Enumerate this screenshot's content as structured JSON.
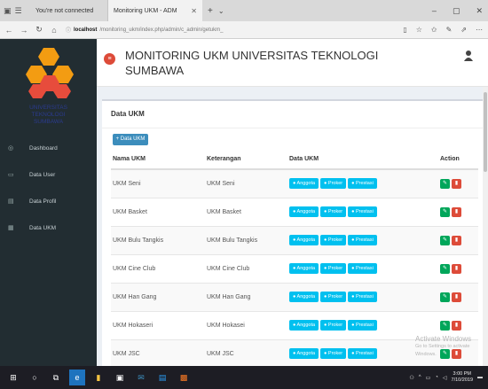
{
  "browser": {
    "tab_inactive": "You're not connected",
    "tab_active": "Monitoring UKM - ADM",
    "new_tab": "+",
    "url_host": "localhost",
    "url_path": "/monitoring_ukm/index.php/admin/c_admin/getukm_"
  },
  "sidebar": {
    "brand_lines": [
      "UNIVERSITAS",
      "TEKNOLOGI",
      "SUMBAWA"
    ],
    "items": [
      {
        "label": "Dashboard",
        "icon": "dashboard-icon"
      },
      {
        "label": "Data User",
        "icon": "monitor-icon"
      },
      {
        "label": "Data Profil",
        "icon": "file-icon"
      },
      {
        "label": "Data UKM",
        "icon": "grid-icon"
      }
    ]
  },
  "header": {
    "title": "MONITORING UKM UNIVERSITAS TEKNOLOGI SUMBAWA"
  },
  "box": {
    "title": "Data UKM",
    "add_button": "+ Data UKM"
  },
  "table": {
    "headers": [
      "Nama UKM",
      "Keterangan",
      "Data UKM",
      "Action"
    ],
    "row_buttons": [
      "Anggota",
      "Proker",
      "Prestasi"
    ],
    "rows": [
      {
        "nama": "UKM Seni",
        "keterangan": "UKM Seni"
      },
      {
        "nama": "UKM Basket",
        "keterangan": "UKM Basket"
      },
      {
        "nama": "UKM Bulu Tangkis",
        "keterangan": "UKM Bulu Tangkis"
      },
      {
        "nama": "UKM Cine Club",
        "keterangan": "UKM Cine Club"
      },
      {
        "nama": "UKM Han Gang",
        "keterangan": "UKM Han Gang"
      },
      {
        "nama": "UKM Hokaseri",
        "keterangan": "UKM Hokasei"
      },
      {
        "nama": "UKM JSC",
        "keterangan": "UKM JSC"
      }
    ]
  },
  "watermark": {
    "line1": "Activate Windows",
    "line2": "Go to Settings to activate Windows."
  },
  "taskbar": {
    "time": "3:00 PM",
    "date": "7/10/2019"
  },
  "colors": {
    "sidebar_bg": "#222d32",
    "primary": "#3c8dbc",
    "info": "#00c0ef",
    "success": "#00a65a",
    "danger": "#dd4b39"
  }
}
